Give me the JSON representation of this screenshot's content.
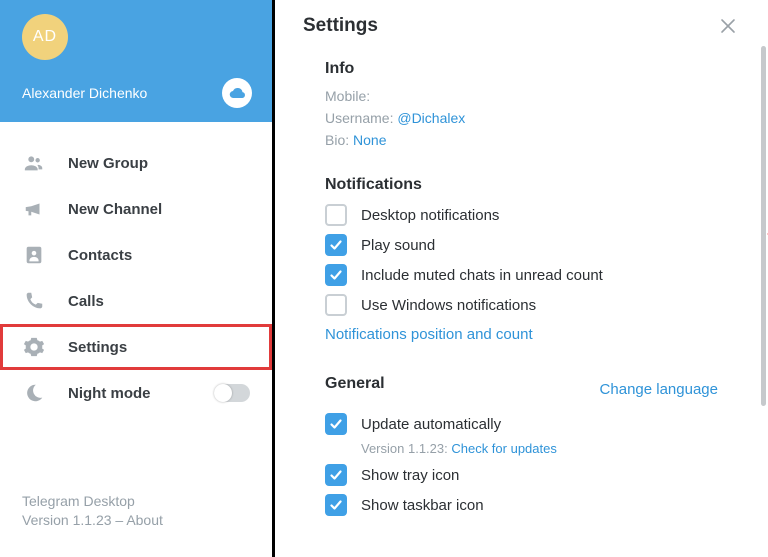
{
  "user": {
    "initials": "AD",
    "name": "Alexander Dichenko"
  },
  "menu": {
    "new_group": "New Group",
    "new_channel": "New Channel",
    "contacts": "Contacts",
    "calls": "Calls",
    "settings": "Settings",
    "night_mode": "Night mode"
  },
  "footer": {
    "appname": "Telegram Desktop",
    "version_prefix": "Version 1.1.23 – ",
    "about": "About"
  },
  "panel": {
    "title": "Settings",
    "info": {
      "heading": "Info",
      "mobile_label": "Mobile:",
      "username_label": "Username: ",
      "username_value": "@Dichalex",
      "bio_label": "Bio: ",
      "bio_value": "None"
    },
    "notifications": {
      "heading": "Notifications",
      "desktop": "Desktop notifications",
      "play_sound": "Play sound",
      "include_muted": "Include muted chats in unread count",
      "windows_notif": "Use Windows notifications",
      "position_link": "Notifications position and count"
    },
    "general": {
      "heading": "General",
      "change_lang": "Change language",
      "update_auto": "Update automatically",
      "update_sub_prefix": "Version 1.1.23: ",
      "update_check": "Check for updates",
      "show_tray": "Show tray icon",
      "show_taskbar": "Show taskbar icon"
    }
  }
}
